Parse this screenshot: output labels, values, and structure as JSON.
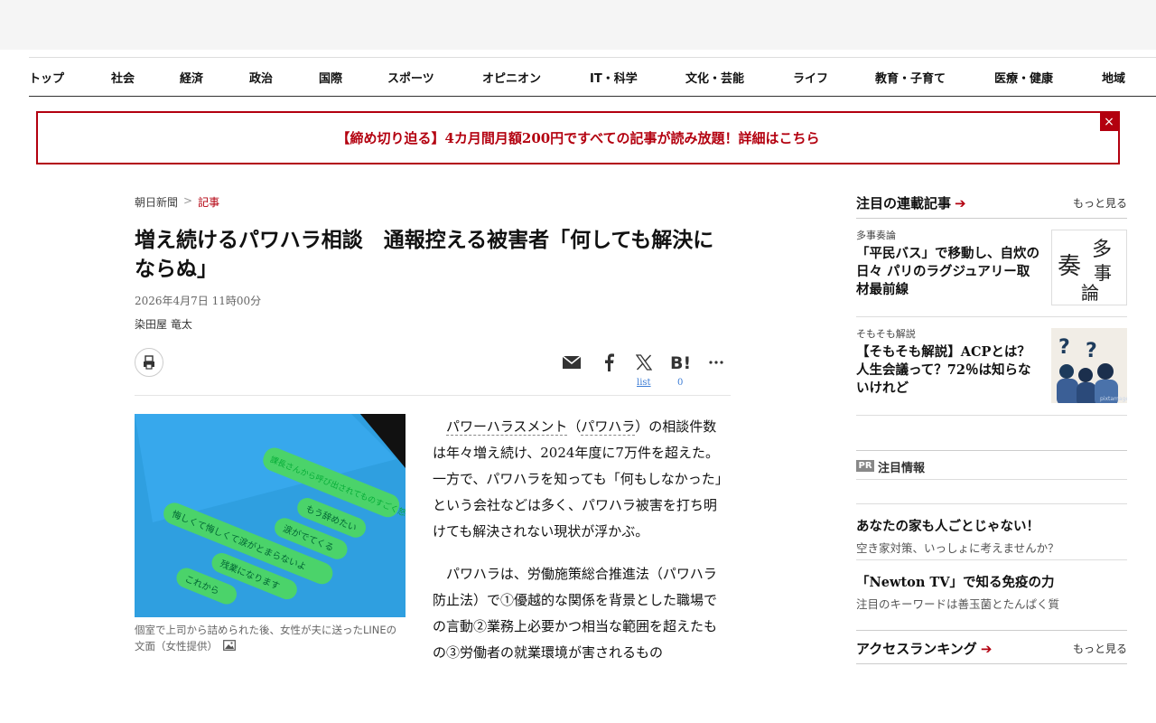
{
  "nav": {
    "items": [
      "トップ",
      "社会",
      "経済",
      "政治",
      "国際",
      "スポーツ",
      "オピニオン",
      "IT・科学",
      "文化・芸能",
      "ライフ",
      "教育・子育て",
      "医療・健康",
      "地域"
    ]
  },
  "banner": {
    "text": "【締め切り迫る】4カ月間月額200円ですべての記事が読み放題！詳細はこちら",
    "close": "×"
  },
  "breadcrumb": {
    "home": "朝日新聞",
    "separator": ">",
    "current": "記事"
  },
  "article": {
    "title": "増え続けるパワハラ相談　通報控える被害者「何しても解決にならぬ」",
    "date": "2026年4月7日 11時00分",
    "author": "染田屋 竜太",
    "share": {
      "list_label": "list",
      "hatena_count": "0"
    },
    "photo_caption": "個室で上司から詰められた後、女性が夫に送ったLINEの文面（女性提供）",
    "body": {
      "p1_link1": "パワーハラスメント",
      "p1_mid": "（",
      "p1_link2": "パワハラ",
      "p1_rest": "）の相談件数は年々増え続け、2024年度に7万件を超えた。一方で、パワハラを知っても「何もしなかった」という会社などは多く、パワハラ被害を打ち明けても解決されない現状が浮かぶ。",
      "p2": "パワハラは、労働施策総合推進法（パワハラ防止法）で①優越的な関係を背景とした職場での言動②業務上必要かつ相当な範囲を超えたもの③労働者の就業環境が害されるもの"
    }
  },
  "sidebar": {
    "series": {
      "title": "注目の連載記事",
      "more": "もっと見る",
      "items": [
        {
          "category": "多事奏論",
          "text": "「平民バス」で移動し、自炊の日々 パリのラグジュアリー取材最前線",
          "thumb_text": "多事奏論"
        },
        {
          "category": "そもそも解説",
          "text": "【そもそも解説】ACPとは？　人生会議って？72％は知らないけれど",
          "thumb_marks": "? ?",
          "thumb_credit": "pixtamage"
        }
      ]
    },
    "pr": {
      "badge": "PR",
      "title": "注目情報",
      "items": [
        {
          "title": "あなたの家も人ごとじゃない！",
          "sub": "空き家対策、いっしょに考えませんか？"
        },
        {
          "title": "「Newton TV」で知る免疫の力",
          "sub": "注目のキーワードは善玉菌とたんぱく質"
        }
      ]
    },
    "ranking": {
      "title": "アクセスランキング",
      "more": "もっと見る"
    }
  },
  "photo_lines": {
    "bubble1": "課長さんから呼び出されてものすごく怒られた",
    "bubble2": "もう辞めたい",
    "bubble3": "涙がでてくる",
    "bubble4": "悔しくて悔しくて涙がとまらないよ",
    "bubble5": "残業になります",
    "bubble6": "これから"
  },
  "colors": {
    "brand_red": "#b3000f",
    "link_blue": "#3a7bd5"
  }
}
